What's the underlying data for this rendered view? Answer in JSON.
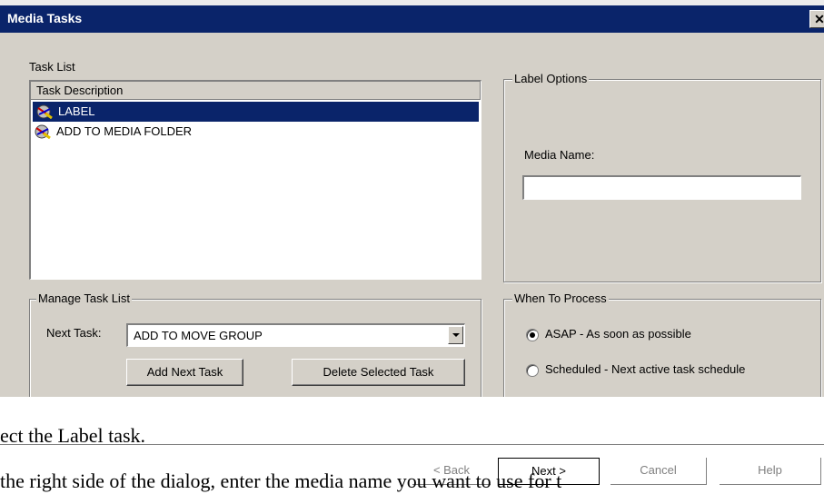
{
  "window": {
    "title": "Media Tasks",
    "close_glyph": "✕"
  },
  "task_list": {
    "label": "Task List",
    "column_header": "Task Description",
    "items": [
      {
        "label": "LABEL",
        "selected": true,
        "icon": "task-icon"
      },
      {
        "label": "ADD TO MEDIA FOLDER",
        "selected": false,
        "icon": "task-icon"
      }
    ]
  },
  "label_options": {
    "legend": "Label Options",
    "media_name_label": "Media Name:",
    "media_name_value": ""
  },
  "manage_task_list": {
    "legend": "Manage Task List",
    "next_task_label": "Next Task:",
    "next_task_value": "ADD TO MOVE GROUP",
    "add_button": "Add Next Task",
    "delete_button": "Delete Selected Task"
  },
  "when_to_process": {
    "legend": "When To Process",
    "options": [
      {
        "label": "ASAP - As soon as possible",
        "checked": true
      },
      {
        "label": "Scheduled - Next active task schedule",
        "checked": false
      }
    ]
  },
  "overlay_text": {
    "line1": "ect the Label task.",
    "line2": "the right side of the dialog, enter the media name you want to use for t"
  },
  "nav_buttons": {
    "back": "< Back",
    "next": "Next >",
    "cancel": "Cancel",
    "help": "Help"
  },
  "colors": {
    "title_bar": "#0a246a",
    "selection": "#0a246a",
    "dialog_bg": "#d4d0c8"
  }
}
